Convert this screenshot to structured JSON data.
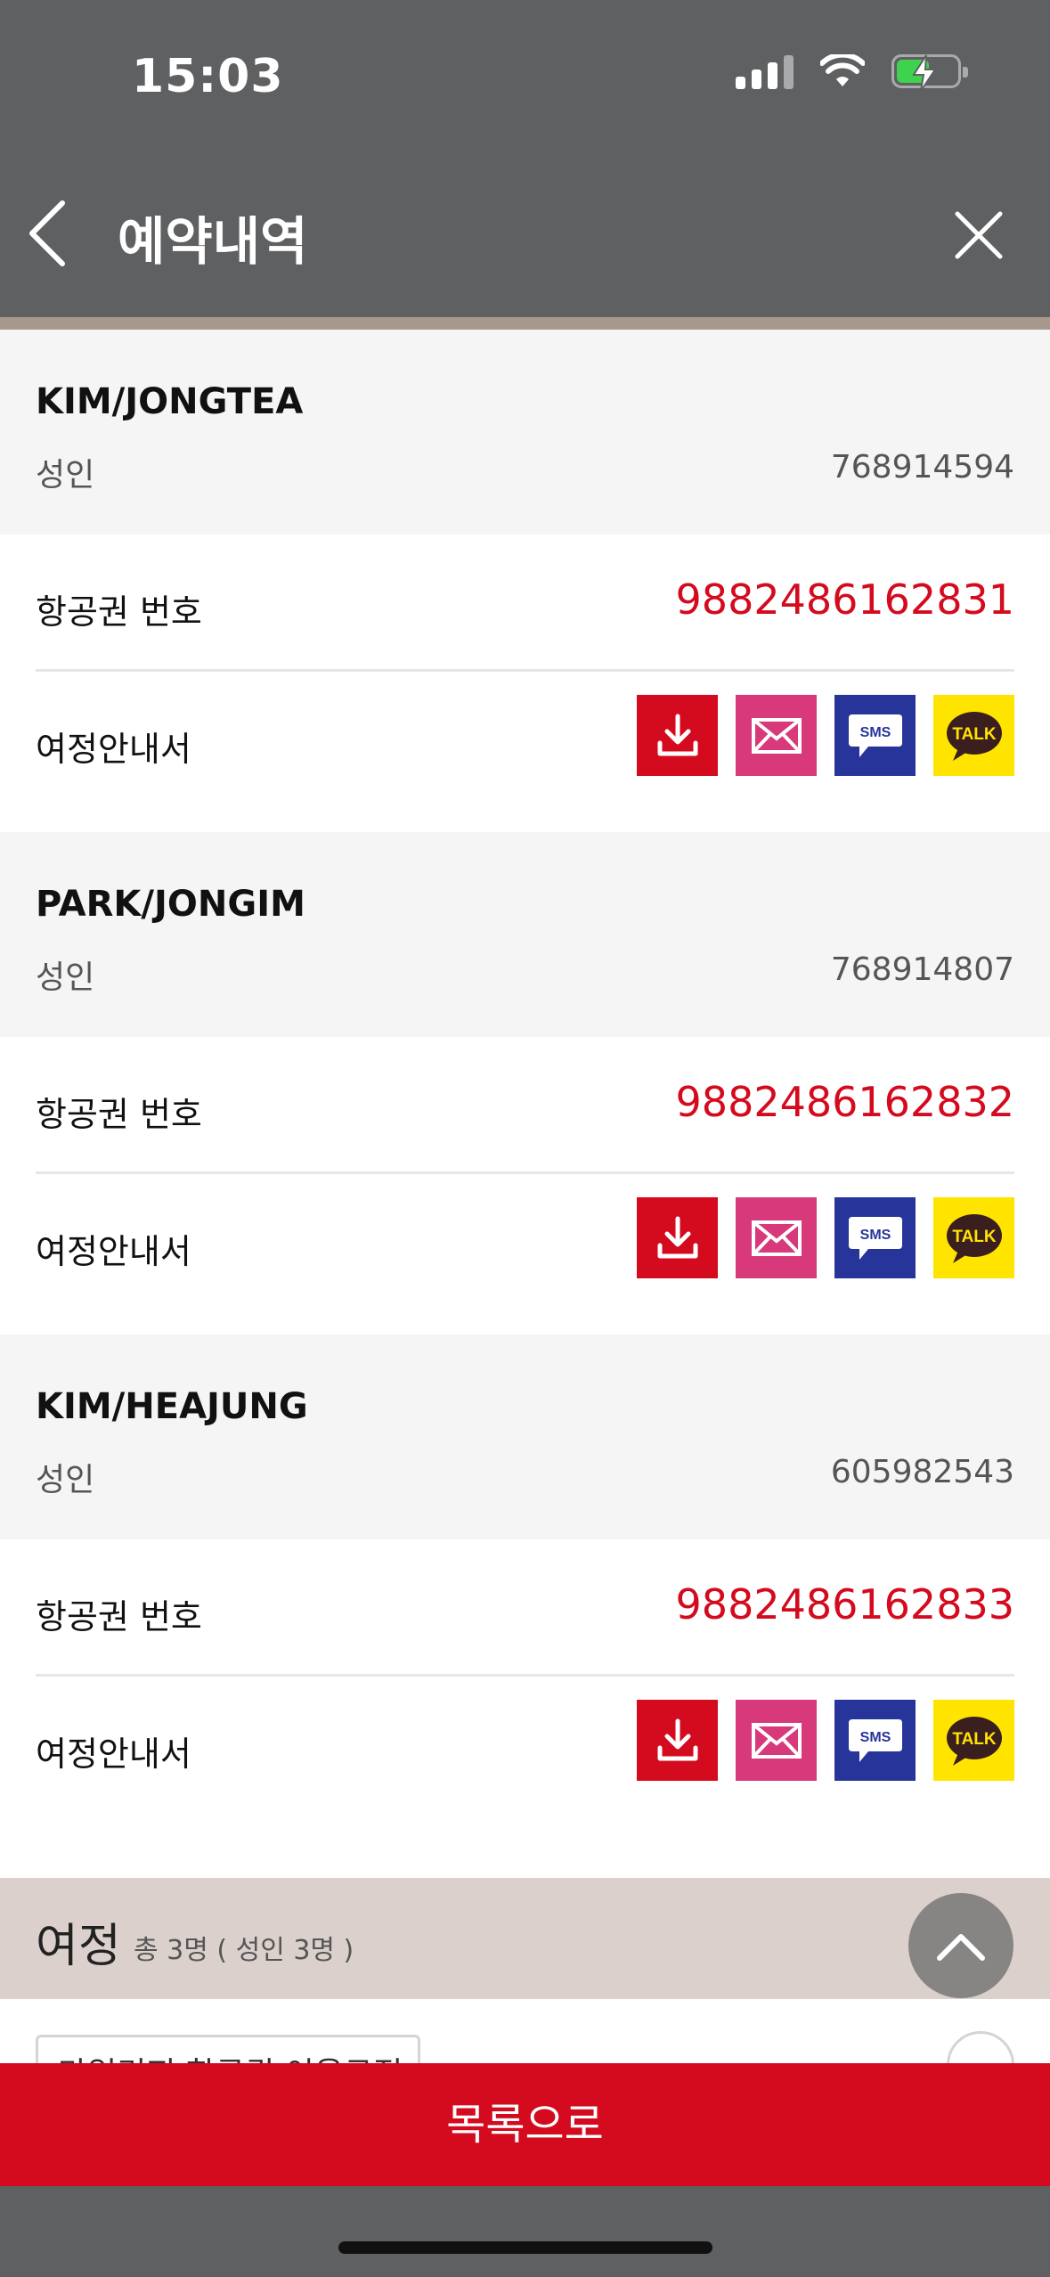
{
  "status_bar": {
    "time": "15:03"
  },
  "header": {
    "title": "예약내역"
  },
  "labels": {
    "ticket_number": "항공권 번호",
    "itinerary_doc": "여정안내서"
  },
  "share_icons": {
    "sms": "SMS",
    "talk": "TALK"
  },
  "passengers": [
    {
      "name": "KIM/JONGTEA",
      "type": "성인",
      "id": "768914594",
      "ticket_no": "9882486162831"
    },
    {
      "name": "PARK/JONGIM",
      "type": "성인",
      "id": "768914807",
      "ticket_no": "9882486162832"
    },
    {
      "name": "KIM/HEAJUNG",
      "type": "성인",
      "id": "605982543",
      "ticket_no": "9882486162833"
    }
  ],
  "itinerary": {
    "title": "여정",
    "subtitle": "총 3명 ( 성인 3명 )",
    "mileage_button": "마일리지 항공권 이용규정"
  },
  "footer": {
    "list_button": "목록으로"
  },
  "colors": {
    "header_bg": "#5f6062",
    "accent_red": "#d40a1e",
    "mail_pink": "#d7397a",
    "sms_blue": "#27359a",
    "talk_yellow": "#ffe400",
    "itinerary_bar": "#dbd0cb"
  }
}
